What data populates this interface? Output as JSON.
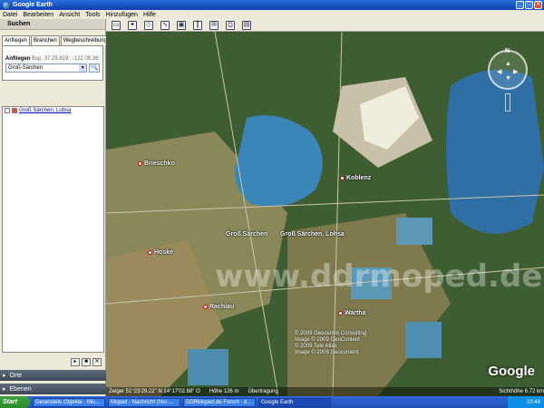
{
  "window": {
    "title": "Google Earth",
    "controls": [
      "_",
      "□",
      "×"
    ]
  },
  "menu": [
    "Datei",
    "Bearbeiten",
    "Ansicht",
    "Tools",
    "Hinzufügen",
    "Hilfe"
  ],
  "sidebar": {
    "header": "Suchen",
    "tabs": [
      "Anfliegen",
      "Branchen",
      "Wegbeschreibung"
    ],
    "search_label": "Anfliegen",
    "search_hint": "Bsp: 37 25.819', -122 05.36'",
    "search_value": "Groß-Särchen",
    "result": "Groß Särchen, Lohsa",
    "panels": [
      "Orte",
      "Ebenen"
    ],
    "player": [
      "▸",
      "■",
      "✕"
    ]
  },
  "map": {
    "places": [
      {
        "label": "Brieschko"
      },
      {
        "label": "Koblenz"
      },
      {
        "label": "Groß Särchen"
      },
      {
        "label": "Groß Särchen, Lohsa"
      },
      {
        "label": "Hoske"
      },
      {
        "label": "Rachlau"
      },
      {
        "label": "Wartha"
      }
    ],
    "watermark": "www.ddrmoped.de",
    "copyright": [
      "© 2009 Geocentre Consulting",
      "Image © 2009 GeoContent",
      "© 2009 Tele Atlas",
      "Image © 2009 Geocontent"
    ],
    "logo": "Google",
    "status": {
      "pointer": "Zeiger  51°23'29.22\" N    14°17'02.68\" O",
      "elev": "Höhe  126 m",
      "stream": "Übertragung",
      "eye": "Sichthöhe  6.72 km"
    },
    "compass_n": "N"
  },
  "taskbar": {
    "start": "Start",
    "tasks": [
      "Gesendete Objekte - Mic...",
      "Moped - Nachricht (Nur-...",
      "DDRMoped.de Forum - d...",
      "Google Earth"
    ],
    "clock": "20:46"
  }
}
